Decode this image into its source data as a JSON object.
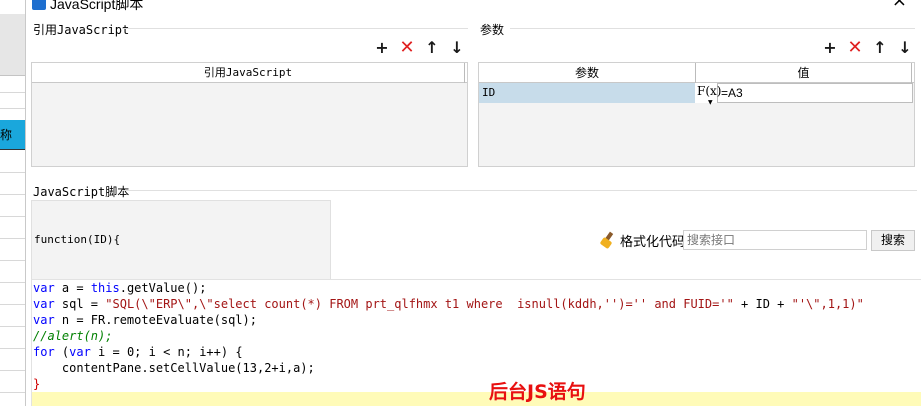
{
  "window": {
    "title": "JavaScript脚本",
    "close_glyph": "×"
  },
  "background_app": {
    "column_label": "称"
  },
  "ref_section": {
    "label": "引用JavaScript",
    "column_header": "引用JavaScript",
    "rows": []
  },
  "param_section": {
    "label": "参数",
    "columns": [
      "参数",
      "值"
    ],
    "rows": [
      {
        "name": "ID",
        "formula_icon": "F(x)",
        "value": "=A3"
      }
    ]
  },
  "toolbar_icons": [
    "add-icon",
    "delete-icon",
    "move-up-icon",
    "move-down-icon"
  ],
  "toolbar_glyphs": {
    "add": "+",
    "delete": "✕",
    "up": "↑",
    "down": "↓"
  },
  "script_section": {
    "label": "JavaScript脚本",
    "function_signature": "function(ID){",
    "format_button": "格式化代码",
    "search_placeholder": "搜索接口",
    "search_button": "搜索"
  },
  "code": {
    "lines": [
      "var a = this.getValue();",
      "var sql = \"SQL(\\\"ERP\\\",\\\"select count(*) FROM prt_qlfhmx t1 where  isnull(kddh,'')='' and FUID='\" + ID + \"'\\\",1,1)\"",
      "var n = FR.remoteEvaluate(sql);",
      "//alert(n);",
      "for (var i = 0; i < n; i++) {",
      "    contentPane.setCellValue(13,2+i,a);",
      "}"
    ]
  },
  "annotation": "后台JS语句",
  "colors": {
    "accent_red": "#e81010",
    "keyword_blue": "#0000ff",
    "string_red": "#a31515",
    "comment_green": "#008000",
    "selected_row": "#c7dcea",
    "highlight_line": "#fffbb8"
  }
}
